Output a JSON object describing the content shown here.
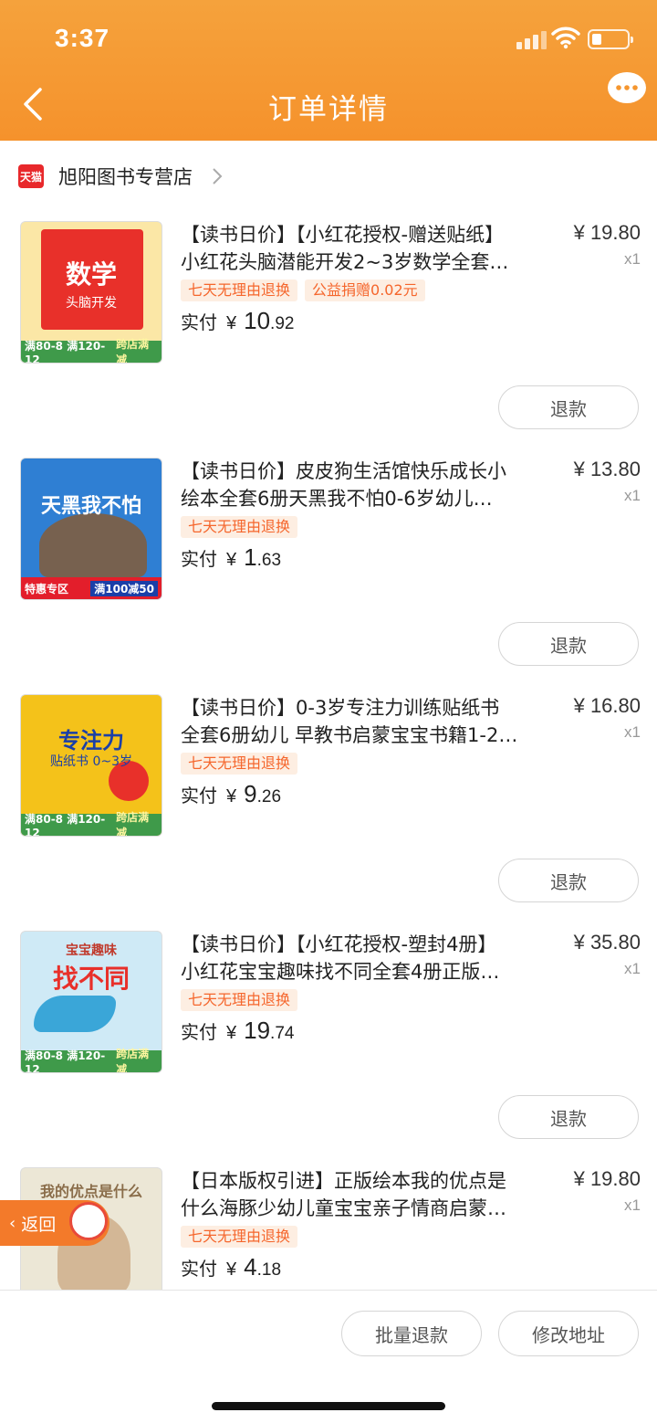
{
  "status_bar": {
    "time": "3:37"
  },
  "nav": {
    "title": "订单详情"
  },
  "store": {
    "badge": "天猫",
    "name": "旭阳图书专营店"
  },
  "items": [
    {
      "title_line1": "【读书日价】【小红花授权-赠送贴纸】",
      "title_line2": "小红花头脑潜能开发2~3岁数学全套…",
      "price": "¥ 19.80",
      "qty": "x1",
      "tags": [
        "七天无理由退换",
        "公益捐赠0.02元"
      ],
      "paid_label": "实付",
      "paid_yen": "¥",
      "paid_int": "10",
      "paid_dec": ".92",
      "refund_label": "退款",
      "cover": {
        "title": "数学",
        "sub": "头脑开发",
        "banner_left": "满80-8 满120-12",
        "banner_right": "跨店满减",
        "color": "#e8302a"
      }
    },
    {
      "title_line1": "【读书日价】皮皮狗生活馆快乐成长小",
      "title_line2": "绘本全套6册天黑我不怕0-6岁幼儿…",
      "price": "¥ 13.80",
      "qty": "x1",
      "tags": [
        "七天无理由退换"
      ],
      "paid_label": "实付",
      "paid_yen": "¥",
      "paid_int": "1",
      "paid_dec": ".63",
      "refund_label": "退款",
      "cover": {
        "title": "天黑我不怕",
        "sub": "",
        "banner_left": "特惠专区",
        "banner_right": "满100减50",
        "color": "#2f7fd3"
      }
    },
    {
      "title_line1": "【读书日价】0-3岁专注力训练贴纸书",
      "title_line2": "全套6册幼儿 早教书启蒙宝宝书籍1-2…",
      "price": "¥ 16.80",
      "qty": "x1",
      "tags": [
        "七天无理由退换"
      ],
      "paid_label": "实付",
      "paid_yen": "¥",
      "paid_int": "9",
      "paid_dec": ".26",
      "refund_label": "退款",
      "cover": {
        "title": "专注力",
        "sub": "贴纸书 0~3岁",
        "banner_left": "满80-8 满120-12",
        "banner_right": "跨店满减",
        "color": "#f4c21a"
      }
    },
    {
      "title_line1": "【读书日价】【小红花授权-塑封4册】",
      "title_line2": "小红花宝宝趣味找不同全套4册正版…",
      "price": "¥ 35.80",
      "qty": "x1",
      "tags": [
        "七天无理由退换"
      ],
      "paid_label": "实付",
      "paid_yen": "¥",
      "paid_int": "19",
      "paid_dec": ".74",
      "refund_label": "退款",
      "cover": {
        "title": "找不同",
        "sub": "宝宝趣味",
        "banner_left": "满80-8 满120-12",
        "banner_right": "跨店满减",
        "color": "#3aa6d8"
      }
    },
    {
      "title_line1": "【日本版权引进】正版绘本我的优点是",
      "title_line2": "什么海豚少幼儿童宝宝亲子情商启蒙…",
      "price": "¥ 19.80",
      "qty": "x1",
      "tags": [
        "七天无理由退换"
      ],
      "paid_label": "实付",
      "paid_yen": "¥",
      "paid_int": "4",
      "paid_dec": ".18",
      "refund_label": "",
      "cover": {
        "title": "我的优点是什么",
        "sub": "",
        "banner_left": "",
        "banner_right": "",
        "color": "#d9d4c2"
      }
    }
  ],
  "float_return": {
    "label": "返回"
  },
  "bottom": {
    "batch_refund": "批量退款",
    "change_address": "修改地址"
  },
  "colors": {
    "header": "#f5962f",
    "tag_text": "#f5662c",
    "tag_bg": "#fdeee2"
  }
}
